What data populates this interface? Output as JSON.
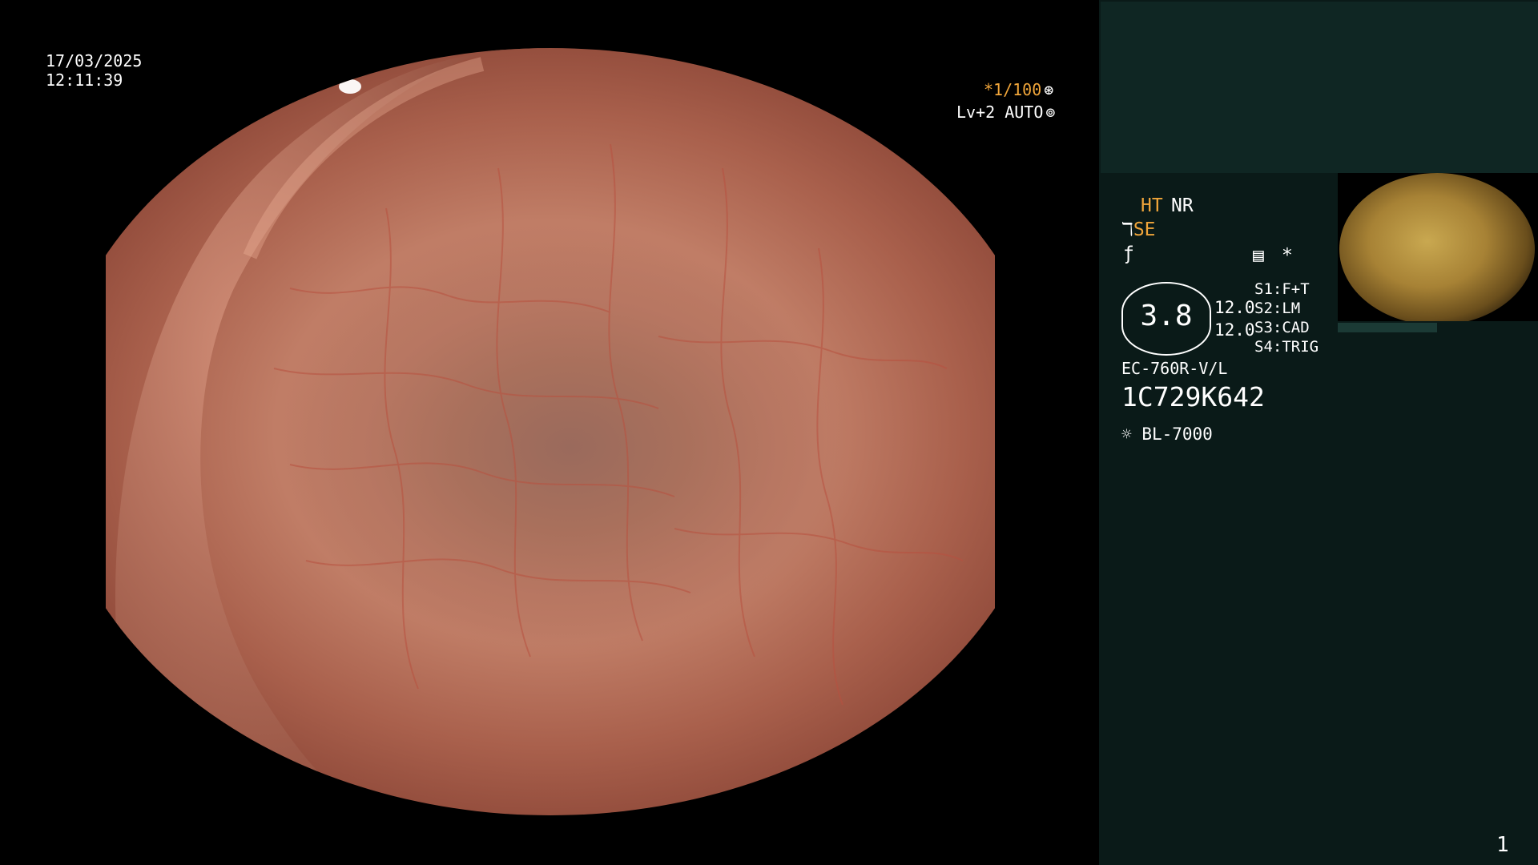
{
  "header": {
    "date": "17/03/2025",
    "time": "12:11:39"
  },
  "overlay": {
    "shutter": "*1/100",
    "shutter_icon": "aperture-icon",
    "level": "Lv+2 AUTO",
    "level_icon": "iris-icon"
  },
  "panel": {
    "ht": "HT",
    "nr": "NR",
    "se": "SE",
    "se_icon": "structure-icon",
    "f_icon": "f-curve-icon",
    "menu_icon": "settings-panel-icon",
    "asterisk": "*",
    "value_main": "3.8",
    "value_a": "12.0",
    "value_b": "12.0",
    "s_items": [
      {
        "key": "S1:",
        "val": "F+T"
      },
      {
        "key": "S2:",
        "val": "LM"
      },
      {
        "key": "S3:",
        "val": "CAD"
      },
      {
        "key": "S4:",
        "val": "TRIG"
      }
    ],
    "scope_model": "EC-760R-V/L",
    "scope_serial": "1C729K642",
    "light_icon": "sun-icon",
    "light_source": "BL-7000",
    "page_number": "1"
  },
  "colors": {
    "accent_orange": "#f0a53a",
    "panel_bg": "#0a1a18",
    "panel_top_bg": "#0f2623"
  }
}
